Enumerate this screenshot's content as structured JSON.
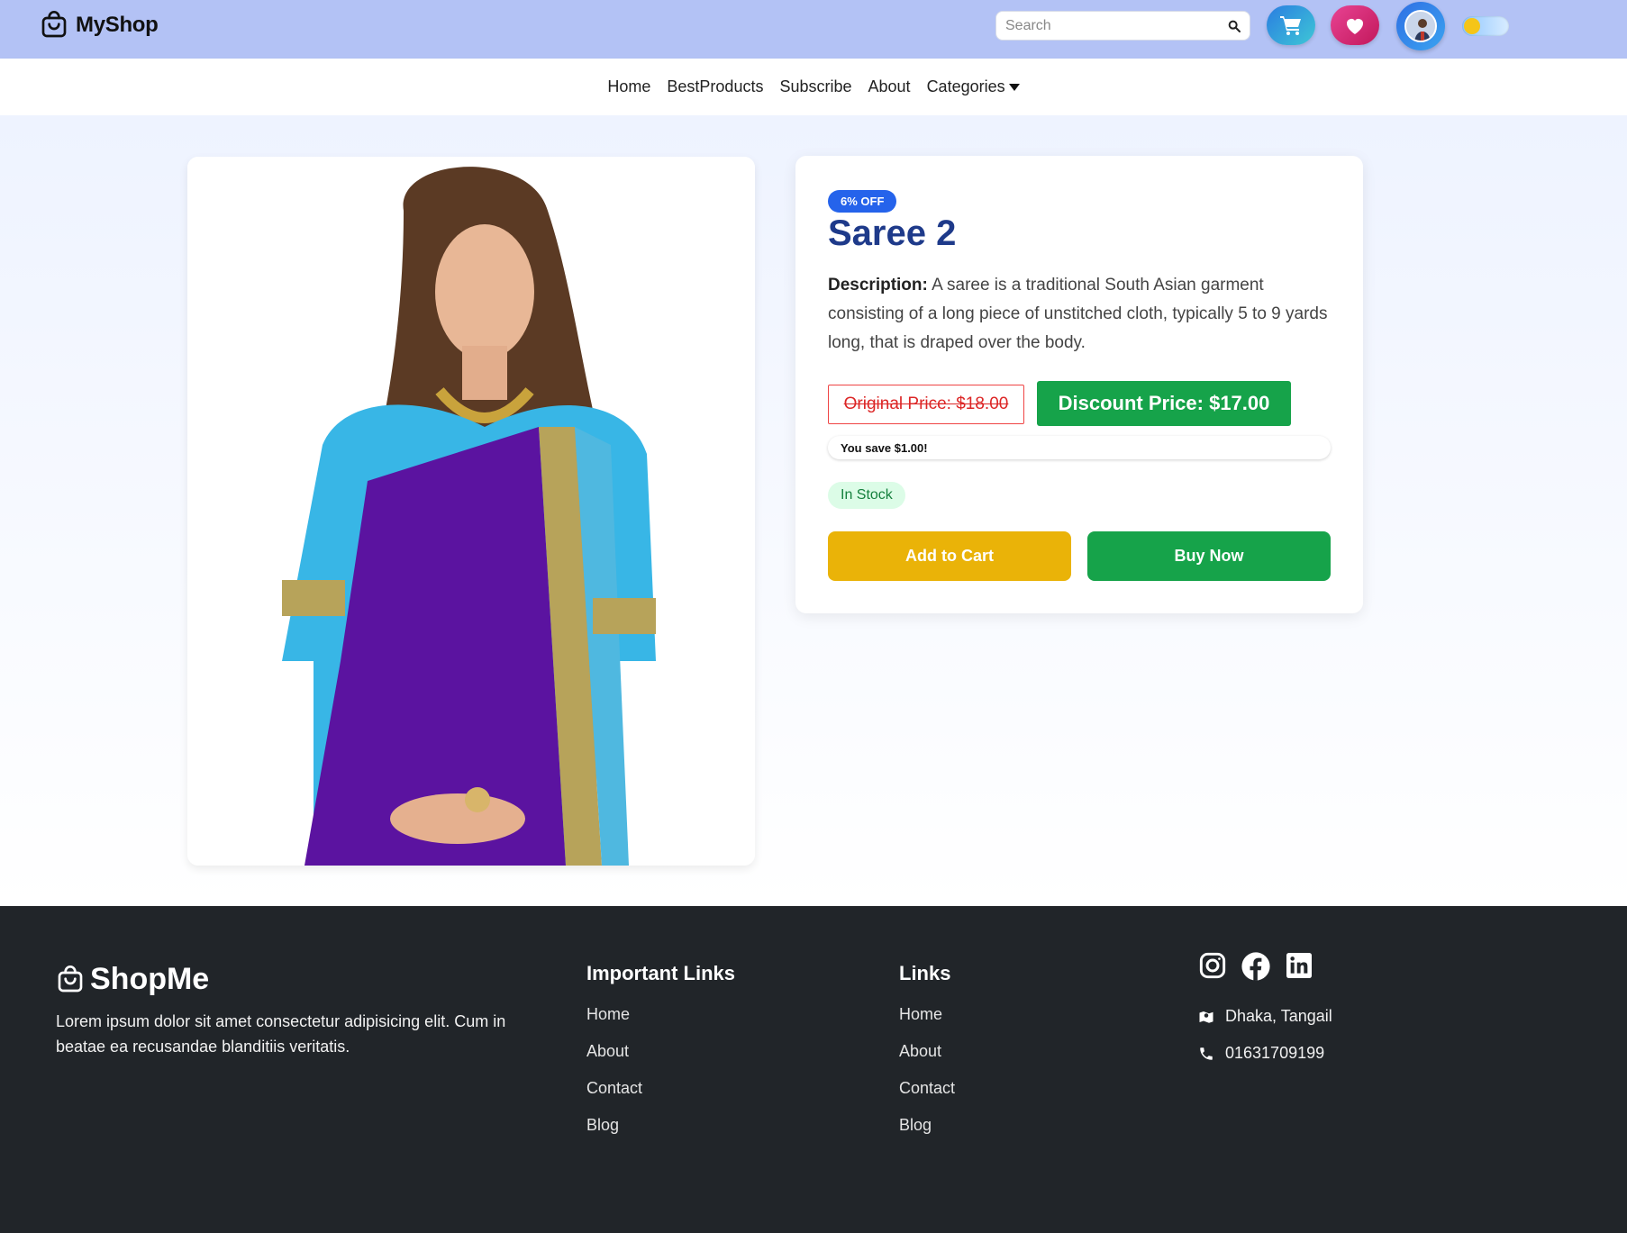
{
  "header": {
    "brand": "MyShop",
    "search_placeholder": "Search"
  },
  "nav": {
    "items": [
      "Home",
      "BestProducts",
      "Subscribe",
      "About",
      "Categories"
    ]
  },
  "product": {
    "discount_badge": "6% OFF",
    "title": "Saree 2",
    "description_label": "Description:",
    "description": "A saree is a traditional South Asian garment consisting of a long piece of unstitched cloth, typically 5 to 9 yards long, that is draped over the body.",
    "original_price": "Original Price: $18.00",
    "discount_price": "Discount Price: $17.00",
    "savings": "You save $1.00!",
    "stock_status": "In Stock",
    "add_to_cart_label": "Add to Cart",
    "buy_now_label": "Buy Now"
  },
  "footer": {
    "brand": "ShopMe",
    "description": "Lorem ipsum dolor sit amet consectetur adipisicing elit. Cum in beatae ea recusandae blanditiis veritatis.",
    "important_links_title": "Important Links",
    "important_links": [
      "Home",
      "About",
      "Contact",
      "Blog"
    ],
    "links_title": "Links",
    "links": [
      "Home",
      "About",
      "Contact",
      "Blog"
    ],
    "address": "Dhaka, Tangail",
    "phone": "01631709199"
  },
  "colors": {
    "header_bg": "#b3c2f5",
    "title_blue": "#1e3a8a",
    "green": "#16a34a",
    "yellow": "#eab308",
    "footer_bg": "#212529"
  }
}
